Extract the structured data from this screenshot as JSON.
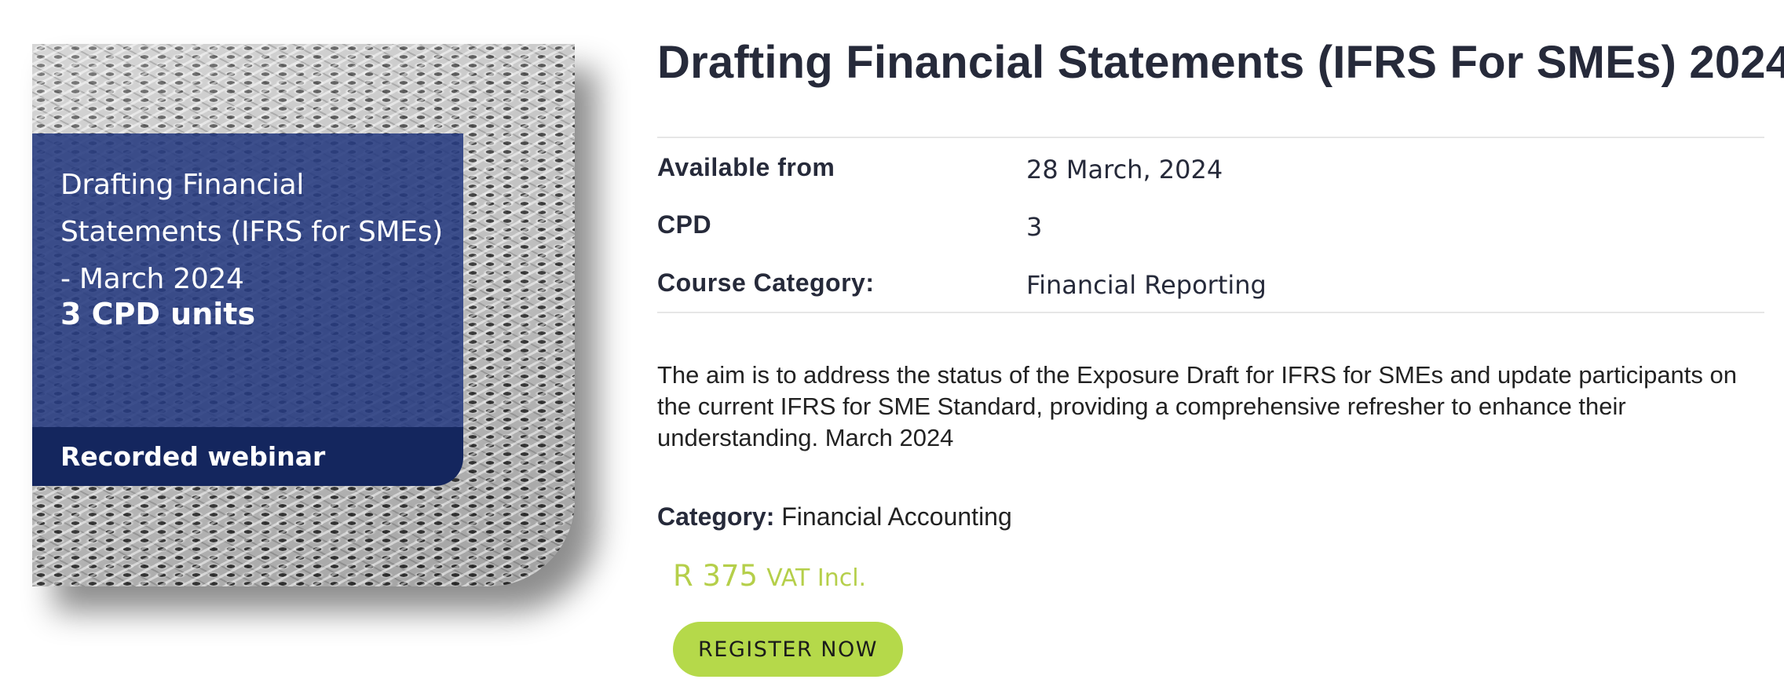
{
  "course_image": {
    "title": "Drafting Financial Statements (IFRS for SMEs) - March 2024",
    "units": "3 CPD units",
    "footer": "Recorded webinar"
  },
  "course": {
    "title": "Drafting Financial Statements (IFRS For SMEs) 2024",
    "meta": [
      {
        "label": "Available from",
        "value": "28 March, 2024"
      },
      {
        "label": "CPD",
        "value": "3"
      },
      {
        "label": "Course Category:",
        "value": "Financial Reporting"
      }
    ],
    "description": "The aim is to address the status of the Exposure Draft for IFRS for SMEs and update participants on the current IFRS for SME Standard, providing a comprehensive refresher to enhance their understanding. March 2024",
    "category_label": "Category:",
    "category_value": "Financial Accounting",
    "price": {
      "amount": "R 375",
      "vat": "VAT Incl."
    },
    "register_label": "REGISTER NOW"
  },
  "colors": {
    "title_text": "#262a3a",
    "panel_blue": "#263a80",
    "panel_footer_navy": "#14265e",
    "price_green": "#b5cf4a",
    "button_green": "#b5d94a"
  }
}
